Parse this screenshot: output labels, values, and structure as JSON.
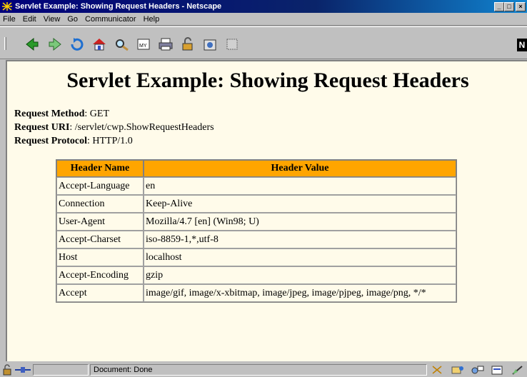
{
  "window": {
    "title": "Servlet Example: Showing Request Headers - Netscape"
  },
  "menu": {
    "items": [
      "File",
      "Edit",
      "View",
      "Go",
      "Communicator",
      "Help"
    ]
  },
  "toolbar": {
    "buttons": [
      "back-icon",
      "forward-icon",
      "reload-icon",
      "home-icon",
      "search-icon",
      "my-netscape-icon",
      "print-icon",
      "security-icon",
      "shop-icon",
      "stop-icon"
    ],
    "brand_icon": "netscape-logo-icon"
  },
  "page": {
    "title": "Servlet Example: Showing Request Headers",
    "request_info": [
      {
        "label": "Request Method",
        "value": "GET"
      },
      {
        "label": "Request URI",
        "value": "/servlet/cwp.ShowRequestHeaders"
      },
      {
        "label": "Request Protocol",
        "value": "HTTP/1.0"
      }
    ],
    "table": {
      "columns": [
        "Header Name",
        "Header Value"
      ],
      "rows": [
        [
          "Accept-Language",
          "en"
        ],
        [
          "Connection",
          "Keep-Alive"
        ],
        [
          "User-Agent",
          "Mozilla/4.7 [en] (Win98; U)"
        ],
        [
          "Accept-Charset",
          "iso-8859-1,*,utf-8"
        ],
        [
          "Host",
          "localhost"
        ],
        [
          "Accept-Encoding",
          "gzip"
        ],
        [
          "Accept",
          "image/gif, image/x-xbitmap, image/jpeg, image/pjpeg, image/png, */*"
        ]
      ],
      "header_color": "#ffa500"
    }
  },
  "statusbar": {
    "status_text": "Document: Done"
  },
  "colors": {
    "title_bar": "#0a246a",
    "content_bg": "#fffbea",
    "chrome": "#c0c0c0"
  }
}
